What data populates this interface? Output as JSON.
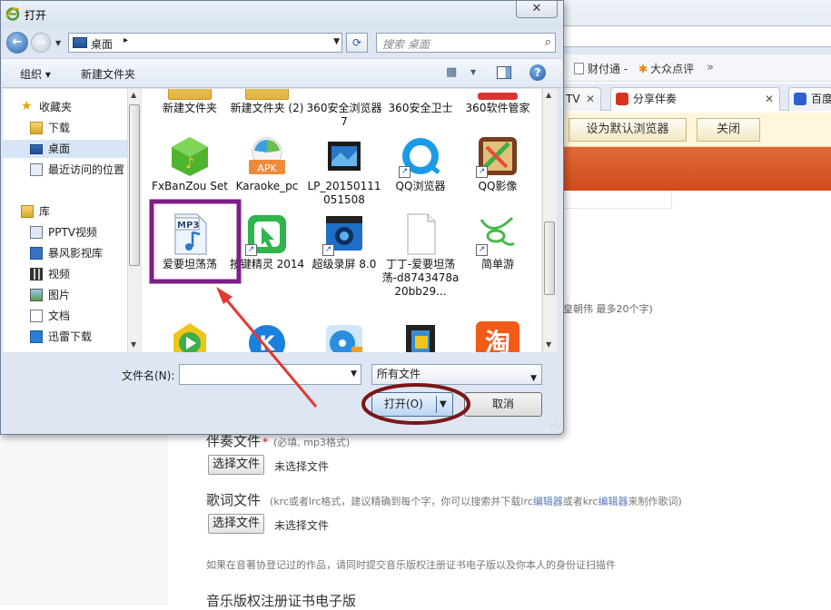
{
  "browser": {
    "favorites": [
      {
        "label": "财付通 -",
        "icon": "page-icon"
      },
      {
        "label": "大众点评",
        "icon": "dianping-icon"
      }
    ],
    "favorites_more": "»",
    "tabs": [
      {
        "label": "TV",
        "close": "✕"
      },
      {
        "label": "分享伴奏",
        "close": "✕",
        "icon_color": "#d9321e"
      },
      {
        "label": "百度",
        "icon_color": "#2f5fd0"
      }
    ],
    "notify_buttons": [
      "设为默认浏览器",
      "关闭"
    ],
    "partial_texts": [
      "皇朝伟 最多20个字)"
    ],
    "form": {
      "accompaniment": {
        "label": "伴奏文件",
        "required": "*",
        "hint": "(必填, mp3格式)",
        "button": "选择文件",
        "status": "未选择文件"
      },
      "lyrics": {
        "label": "歌词文件",
        "hint_pre": "(krc或者lrc格式，建议精确到每个字，你可以搜索并下载lrc",
        "hint_link1": "编辑器",
        "hint_mid": "或者krc",
        "hint_link2": "编辑器",
        "hint_post": "来制作歌词)",
        "button": "选择文件",
        "status": "未选择文件"
      },
      "note": "如果在音著协登记过的作品，请同时提交音乐版权注册证书电子版以及你本人的身份证扫描件",
      "cert_label": "音乐版权注册证书电子版"
    }
  },
  "dialog": {
    "title": "打开",
    "close_label": "✕",
    "address": {
      "location": "桌面",
      "separator": "▸"
    },
    "search_placeholder": "搜索 桌面",
    "toolbar": {
      "organize": "组织 ▾",
      "new_folder": "新建文件夹"
    },
    "nav": {
      "favorites_header": "收藏夹",
      "favorites": [
        "下载",
        "桌面",
        "最近访问的位置"
      ],
      "library_header": "库",
      "library": [
        "PPTV视频",
        "暴风影视库",
        "视频",
        "图片",
        "文档",
        "迅雷下载"
      ]
    },
    "files": [
      {
        "name": "新建文件夹",
        "icon": "folder-icon"
      },
      {
        "name": "新建文件夹 (2)",
        "icon": "folder-icon"
      },
      {
        "name": "360安全浏览器7",
        "icon": "browser-360-icon"
      },
      {
        "name": "360安全卫士",
        "icon": "guard-360-icon"
      },
      {
        "name": "360软件管家",
        "icon": "software-360-icon"
      },
      {
        "name": "FxBanZou Setup",
        "icon": "fxbanzou-icon"
      },
      {
        "name": "Karaoke_pc",
        "icon": "apk-icon"
      },
      {
        "name": "LP_20150111051508",
        "icon": "video-file-icon"
      },
      {
        "name": "QQ浏览器",
        "icon": "qq-browser-icon"
      },
      {
        "name": "QQ影像",
        "icon": "qq-image-icon"
      },
      {
        "name": "爱要坦荡荡",
        "icon": "mp3-file-icon",
        "badge": "MP3"
      },
      {
        "name": "按键精灵 2014",
        "icon": "keyboard-sprite-icon"
      },
      {
        "name": "超级录屏 8.0",
        "icon": "screen-recorder-icon"
      },
      {
        "name": "丁丁-爱要坦荡荡-d8743478a20bb29...",
        "icon": "blank-file-icon"
      },
      {
        "name": "简单游",
        "icon": "simple-game-icon"
      },
      {
        "name": "",
        "icon": "media-player-icon"
      },
      {
        "name": "",
        "icon": "kugou-icon"
      },
      {
        "name": "",
        "icon": "disc-icon"
      },
      {
        "name": "",
        "icon": "film-icon"
      },
      {
        "name": "",
        "icon": "taobao-icon"
      }
    ],
    "taobao_glyph": "淘",
    "filename_label": "文件名(N):",
    "filename_value": "",
    "filetype": "所有文件",
    "open_label": "打开(O)",
    "cancel_label": "取消"
  },
  "colors": {
    "highlight_box": "#7b1f86",
    "oval": "#7a1616",
    "arrow": "#e23a2f",
    "accent_red": "#cf4b1d"
  }
}
